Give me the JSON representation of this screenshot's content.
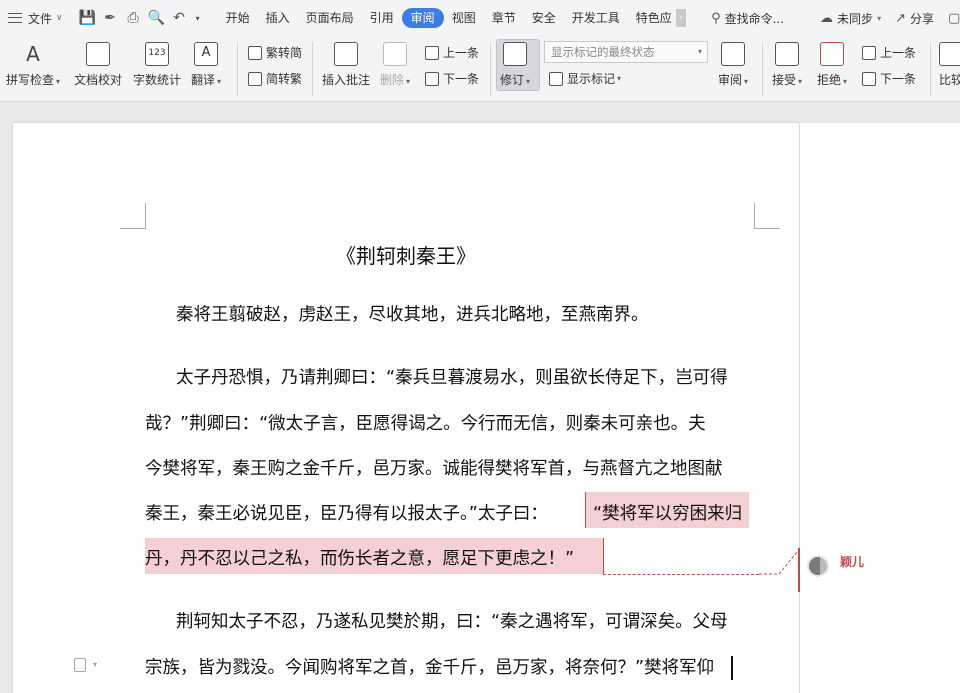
{
  "menubar": {
    "file_label": "文件",
    "tabs": [
      "开始",
      "插入",
      "页面布局",
      "引用",
      "审阅",
      "视图",
      "章节",
      "安全",
      "开发工具",
      "特色应"
    ],
    "active_tab": "审阅",
    "search_label": "查找命令...",
    "sync_label": "未同步",
    "share_label": "分享"
  },
  "ribbon": {
    "spell_check": "拼写检查",
    "doc_proof": "文档校对",
    "word_count": "字数统计",
    "translate": "翻译",
    "trad_to_simp": "繁转简",
    "simp_to_trad": "简转繁",
    "insert_comment": "插入批注",
    "delete": "删除",
    "prev_comment": "上一条",
    "next_comment": "下一条",
    "revise": "修订",
    "display_state": "显示标记的最终状态",
    "show_markup": "显示标记",
    "review": "审阅",
    "accept": "接受",
    "reject": "拒绝",
    "prev_change": "上一条",
    "next_change": "下一条",
    "compare": "比较"
  },
  "document": {
    "title": "《荆轲刺秦王》",
    "p1": "秦将王翦破赵，虏赵王，尽收其地，进兵北略地，至燕南界。",
    "p2_l1": "太子丹恐惧，乃请荆卿曰：“秦兵旦暮渡易水，则虽欲长侍足下，岂可得",
    "p2_l2": "哉？”荆卿曰：“微太子言，臣愿得谒之。今行而无信，则秦未可亲也。夫",
    "p2_l3": "今樊将军，秦王购之金千斤，邑万家。诚能得樊将军首，与燕督亢之地图献",
    "p2_l4a": "秦王，秦王必说见臣，臣乃得有以报太子。”太子曰：",
    "p2_l4b": "“樊将军以穷困来归",
    "p2_l5": "丹，丹不忍以己之私，而伤长者之意，愿足下更虑之！”",
    "p3_l1": "荆轲知太子不忍，乃遂私见樊於期，曰：“秦之遇将军，可谓深矣。父母",
    "p3_l2": "宗族，皆为戮没。今闻购将军之首，金千斤，邑万家，将奈何？”樊将军仰"
  },
  "comment": {
    "author": "颖儿"
  }
}
